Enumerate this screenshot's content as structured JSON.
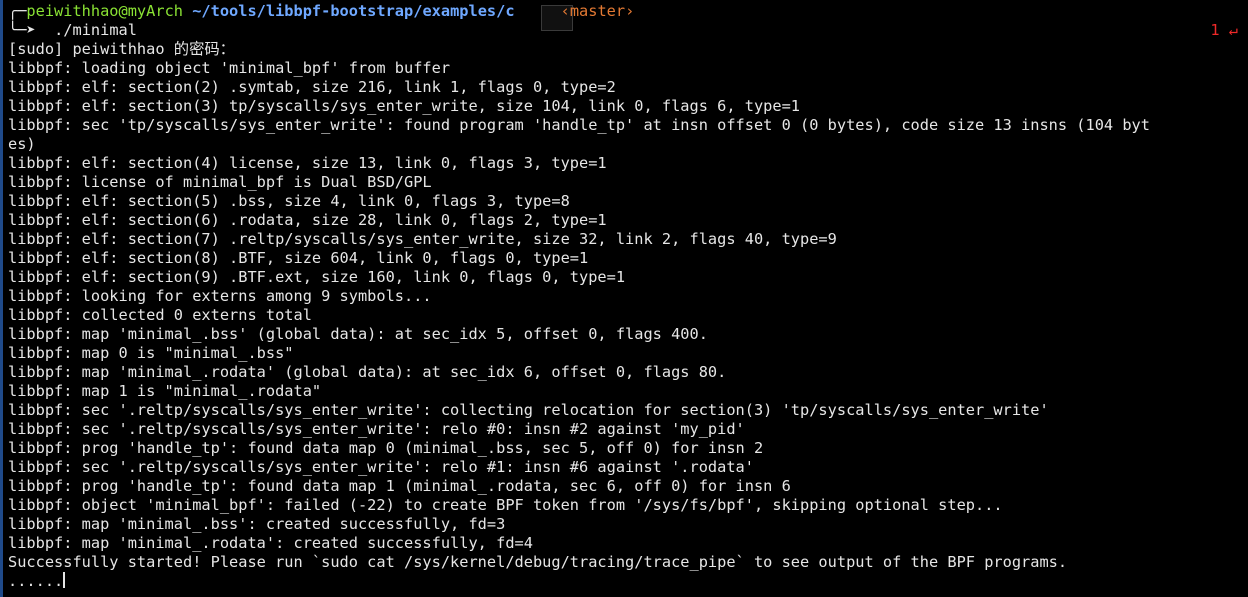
{
  "prompt": {
    "user_host": "peiwithhao@myArch",
    "path": "~/tools/libbpf-bootstrap/examples/c",
    "branch": "‹master›",
    "command": "./minimal",
    "exit_status": "1 ↵"
  },
  "output": [
    "[sudo] peiwithhao 的密码：",
    "libbpf: loading object 'minimal_bpf' from buffer",
    "libbpf: elf: section(2) .symtab, size 216, link 1, flags 0, type=2",
    "libbpf: elf: section(3) tp/syscalls/sys_enter_write, size 104, link 0, flags 6, type=1",
    "libbpf: sec 'tp/syscalls/sys_enter_write': found program 'handle_tp' at insn offset 0 (0 bytes), code size 13 insns (104 byt",
    "es)",
    "libbpf: elf: section(4) license, size 13, link 0, flags 3, type=1",
    "libbpf: license of minimal_bpf is Dual BSD/GPL",
    "libbpf: elf: section(5) .bss, size 4, link 0, flags 3, type=8",
    "libbpf: elf: section(6) .rodata, size 28, link 0, flags 2, type=1",
    "libbpf: elf: section(7) .reltp/syscalls/sys_enter_write, size 32, link 2, flags 40, type=9",
    "libbpf: elf: section(8) .BTF, size 604, link 0, flags 0, type=1",
    "libbpf: elf: section(9) .BTF.ext, size 160, link 0, flags 0, type=1",
    "libbpf: looking for externs among 9 symbols...",
    "libbpf: collected 0 externs total",
    "libbpf: map 'minimal_.bss' (global data): at sec_idx 5, offset 0, flags 400.",
    "libbpf: map 0 is \"minimal_.bss\"",
    "libbpf: map 'minimal_.rodata' (global data): at sec_idx 6, offset 0, flags 80.",
    "libbpf: map 1 is \"minimal_.rodata\"",
    "libbpf: sec '.reltp/syscalls/sys_enter_write': collecting relocation for section(3) 'tp/syscalls/sys_enter_write'",
    "libbpf: sec '.reltp/syscalls/sys_enter_write': relo #0: insn #2 against 'my_pid'",
    "libbpf: prog 'handle_tp': found data map 0 (minimal_.bss, sec 5, off 0) for insn 2",
    "libbpf: sec '.reltp/syscalls/sys_enter_write': relo #1: insn #6 against '.rodata'",
    "libbpf: prog 'handle_tp': found data map 1 (minimal_.rodata, sec 6, off 0) for insn 6",
    "libbpf: object 'minimal_bpf': failed (-22) to create BPF token from '/sys/fs/bpf', skipping optional step...",
    "libbpf: map 'minimal_.bss': created successfully, fd=3",
    "libbpf: map 'minimal_.rodata': created successfully, fd=4",
    "Successfully started! Please run `sudo cat /sys/kernel/debug/tracing/trace_pipe` to see output of the BPF programs.",
    "......"
  ]
}
